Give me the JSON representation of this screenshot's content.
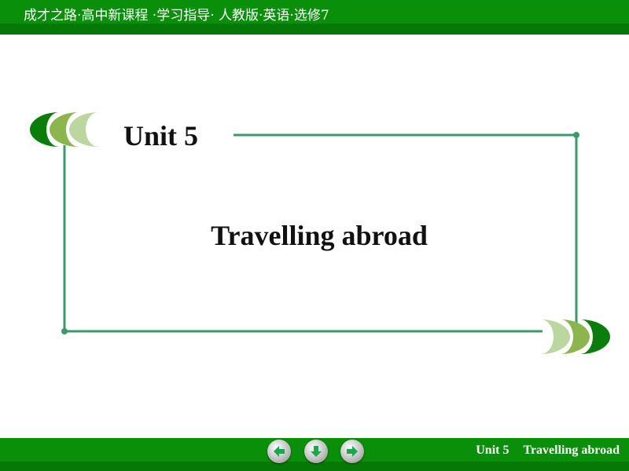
{
  "header": {
    "text": "成才之路·高中新课程 ·学习指导· 人教版·英语·选修7"
  },
  "slide": {
    "title": "Unit 5",
    "subtitle": "Travelling abroad"
  },
  "footer": {
    "unit": "Unit 5",
    "topic": "Travelling abroad",
    "buttons": [
      {
        "icon": "arrow-left-icon"
      },
      {
        "icon": "arrow-down-icon"
      },
      {
        "icon": "arrow-right-icon"
      }
    ]
  },
  "colors": {
    "bar": "#0a8f0a",
    "frame": "#3a9a6a",
    "crescent_dark": "#0a7d0a",
    "crescent_mid": "#8cb54e",
    "crescent_light": "#bcd6a0",
    "arrow": "#1aa84a"
  }
}
